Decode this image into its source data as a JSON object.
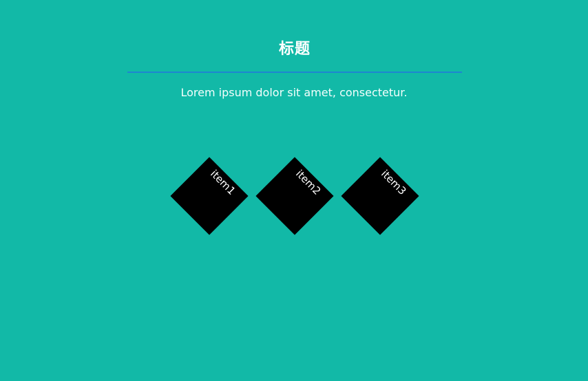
{
  "header": {
    "title": "标题",
    "divider_color": "#1e86d1"
  },
  "intro": {
    "text": "Lorem ipsum dolor sit amet, consectetur."
  },
  "items": [
    {
      "label": "item1"
    },
    {
      "label": "item2"
    },
    {
      "label": "item3"
    }
  ],
  "colors": {
    "background": "#12b9a7",
    "diamond": "#000000",
    "text": "#ffffff"
  }
}
